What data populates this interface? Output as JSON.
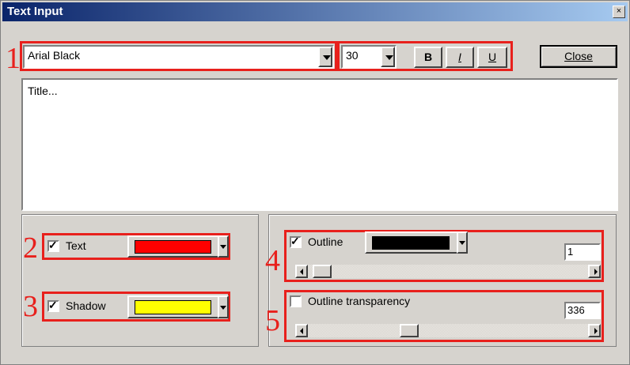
{
  "window": {
    "title": "Text Input",
    "close_glyph": "×"
  },
  "annotations": [
    "1",
    "2",
    "3",
    "4",
    "5"
  ],
  "toolbar": {
    "font_name": "Arial Black",
    "font_size": "30",
    "bold_label": "B",
    "italic_label": "I",
    "underline_label": "U",
    "close_label": "Close"
  },
  "text_area": {
    "value": "Title..."
  },
  "left_panel": {
    "text_label": "Text",
    "text_checked": true,
    "text_color": "#ff0000",
    "shadow_label": "Shadow",
    "shadow_checked": true,
    "shadow_color": "#ffff00"
  },
  "right_panel": {
    "outline_label": "Outline",
    "outline_checked": true,
    "outline_color": "#000000",
    "outline_value": "1",
    "transparency_label": "Outline transparency",
    "transparency_checked": false,
    "transparency_value": "336"
  },
  "colors": {
    "annotation_red": "#e8201c",
    "face": "#d6d3ce",
    "title_start": "#0a246a",
    "title_end": "#a6caf0"
  }
}
